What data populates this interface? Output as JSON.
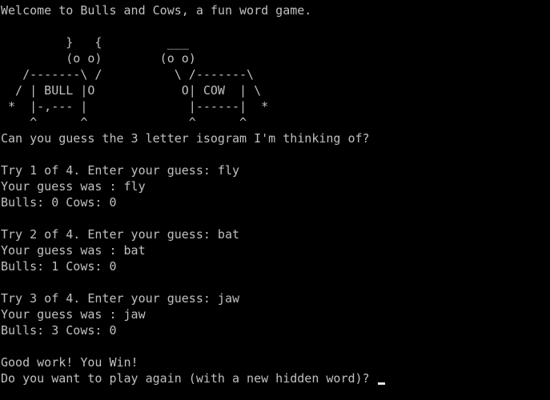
{
  "terminal": {
    "lines": [
      "Welcome to Bulls and Cows, a fun word game.",
      "",
      "         }   {         ___",
      "         (o o)        (o o)",
      "   /-------\\ /          \\ /-------\\",
      "  / | BULL |O            O| COW  | \\",
      " *  |-,--- |              |------|  *",
      "    ^      ^              ^      ^",
      "Can you guess the 3 letter isogram I'm thinking of?",
      "",
      "Try 1 of 4. Enter your guess: fly",
      "Your guess was : fly",
      "Bulls: 0 Cows: 0",
      "",
      "Try 2 of 4. Enter your guess: bat",
      "Your guess was : bat",
      "Bulls: 1 Cows: 0",
      "",
      "Try 3 of 4. Enter your guess: jaw",
      "Your guess was : jaw",
      "Bulls: 3 Cows: 0",
      "",
      "Good work! You Win!",
      "Do you want to play again (with a new hidden word)? "
    ],
    "colors": {
      "background": "#000000",
      "text": "#c0c0c0",
      "cursor": "#e6e6e6"
    }
  }
}
